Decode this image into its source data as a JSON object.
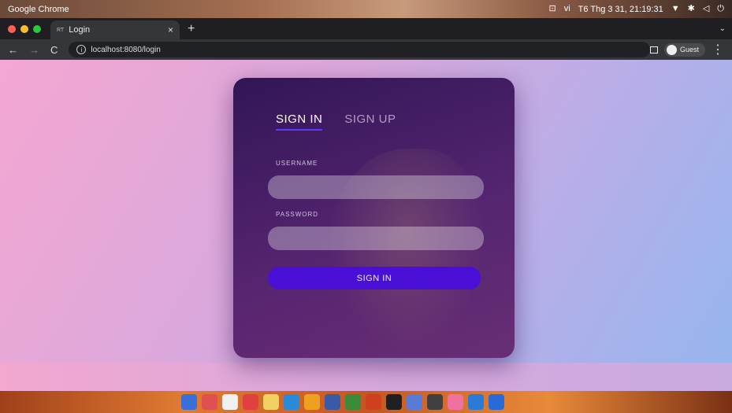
{
  "os": {
    "app_name": "Google Chrome",
    "lang": "vi",
    "datetime": "T6 Thg 3 31, 21:19:31",
    "icons": [
      "screenshot-icon",
      "wifi-icon",
      "bluetooth-icon",
      "volume-icon",
      "power-icon"
    ]
  },
  "browser": {
    "tab_title": "Login",
    "tab_favicon": "RT",
    "url": "localhost:8080/login",
    "profile_label": "Guest"
  },
  "login": {
    "tab_signin": "SIGN IN",
    "tab_signup": "SIGN UP",
    "username_label": "USERNAME",
    "username_value": "",
    "password_label": "PASSWORD",
    "password_value": "",
    "submit_label": "SIGN IN"
  },
  "dock": {
    "colors": [
      "#3a6fd8",
      "#e05050",
      "#f0f0f0",
      "#e04040",
      "#f0d060",
      "#2a8ad8",
      "#f0a020",
      "#3a5aa8",
      "#3a8a3a",
      "#d04020",
      "#202020",
      "#5a7ad8",
      "#404040",
      "#f070a0",
      "#2a7ad8",
      "#2a6ad8"
    ]
  }
}
